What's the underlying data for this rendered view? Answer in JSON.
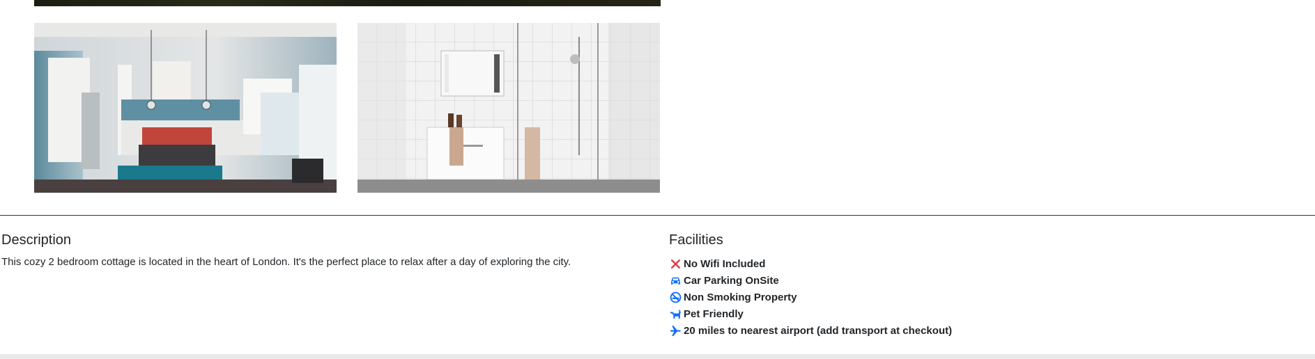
{
  "gallery": {
    "images": [
      {
        "name": "kitchen-photo",
        "subject": "kitchen"
      },
      {
        "name": "bathroom-photo",
        "subject": "bathroom"
      }
    ]
  },
  "description": {
    "title": "Description",
    "text": "This cozy 2 bedroom cottage is located in the heart of London. It's the perfect place to relax after a day of exploring the city."
  },
  "facilities": {
    "title": "Facilities",
    "items": [
      {
        "label": "No Wifi Included",
        "icon": "x-icon",
        "color": "#dc3545"
      },
      {
        "label": "Car Parking OnSite",
        "icon": "car-icon",
        "color": "#0d6efd"
      },
      {
        "label": "Non Smoking Property",
        "icon": "no-smoking-icon",
        "color": "#0d6efd"
      },
      {
        "label": "Pet Friendly",
        "icon": "dog-icon",
        "color": "#0d6efd"
      },
      {
        "label": "20 miles to nearest airport (add transport at checkout)",
        "icon": "plane-icon",
        "color": "#0d6efd"
      }
    ]
  }
}
